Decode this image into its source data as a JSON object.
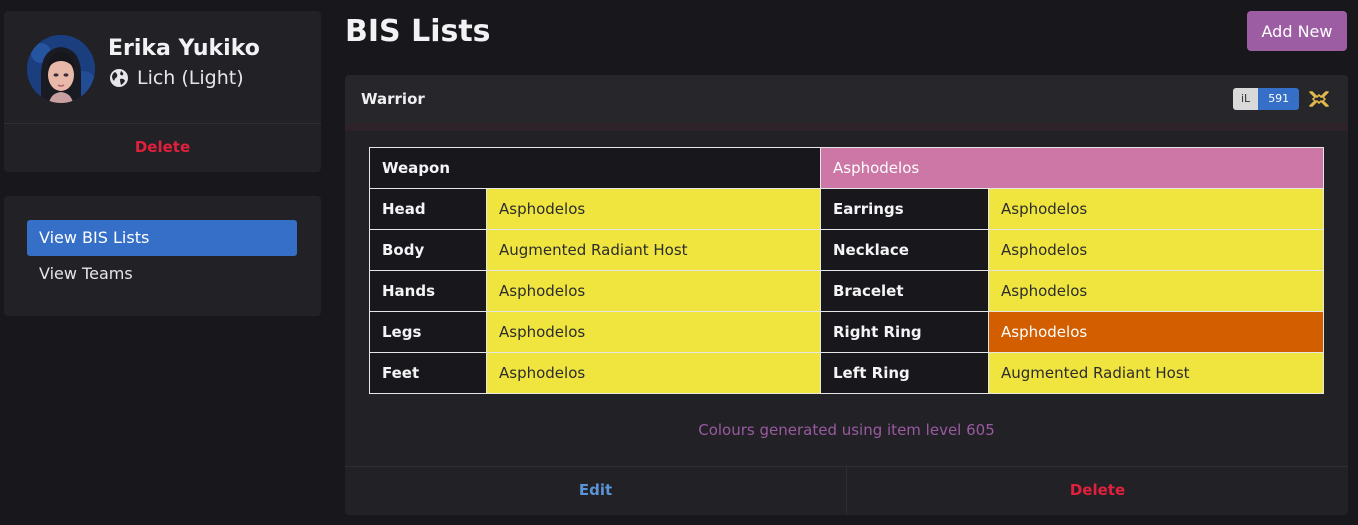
{
  "profile": {
    "name": "Erika Yukiko",
    "server": "Lich (Light)",
    "delete_label": "Delete"
  },
  "nav": {
    "items": [
      {
        "label": "View BIS Lists",
        "active": true
      },
      {
        "label": "View Teams",
        "active": false
      }
    ]
  },
  "page": {
    "title": "BIS Lists",
    "add_new_label": "Add New"
  },
  "bis_list": {
    "job": "Warrior",
    "item_level_label": "iL",
    "item_level": "591",
    "job_icon": "warrior-job-icon",
    "weapon": {
      "slot": "Weapon",
      "item": "Asphodelos",
      "color": "#cd77a6"
    },
    "rows": [
      {
        "left_slot": "Head",
        "left_item": "Asphodelos",
        "left_color": "#f0e53f",
        "right_slot": "Earrings",
        "right_item": "Asphodelos",
        "right_color": "#f0e53f"
      },
      {
        "left_slot": "Body",
        "left_item": "Augmented Radiant Host",
        "left_color": "#f0e53f",
        "right_slot": "Necklace",
        "right_item": "Asphodelos",
        "right_color": "#f0e53f"
      },
      {
        "left_slot": "Hands",
        "left_item": "Asphodelos",
        "left_color": "#f0e53f",
        "right_slot": "Bracelet",
        "right_item": "Asphodelos",
        "right_color": "#f0e53f"
      },
      {
        "left_slot": "Legs",
        "left_item": "Asphodelos",
        "left_color": "#f0e53f",
        "right_slot": "Right Ring",
        "right_item": "Asphodelos",
        "right_color": "#d35e00"
      },
      {
        "left_slot": "Feet",
        "left_item": "Asphodelos",
        "left_color": "#f0e53f",
        "right_slot": "Left Ring",
        "right_item": "Augmented Radiant Host",
        "right_color": "#f0e53f"
      }
    ],
    "footnote": "Colours generated using item level 605",
    "edit_label": "Edit",
    "delete_label": "Delete"
  },
  "colors": {
    "accent_purple": "#9d5da3",
    "active_blue": "#356fc7",
    "danger_red": "#e0203c",
    "edit_blue": "#5a94d6"
  }
}
